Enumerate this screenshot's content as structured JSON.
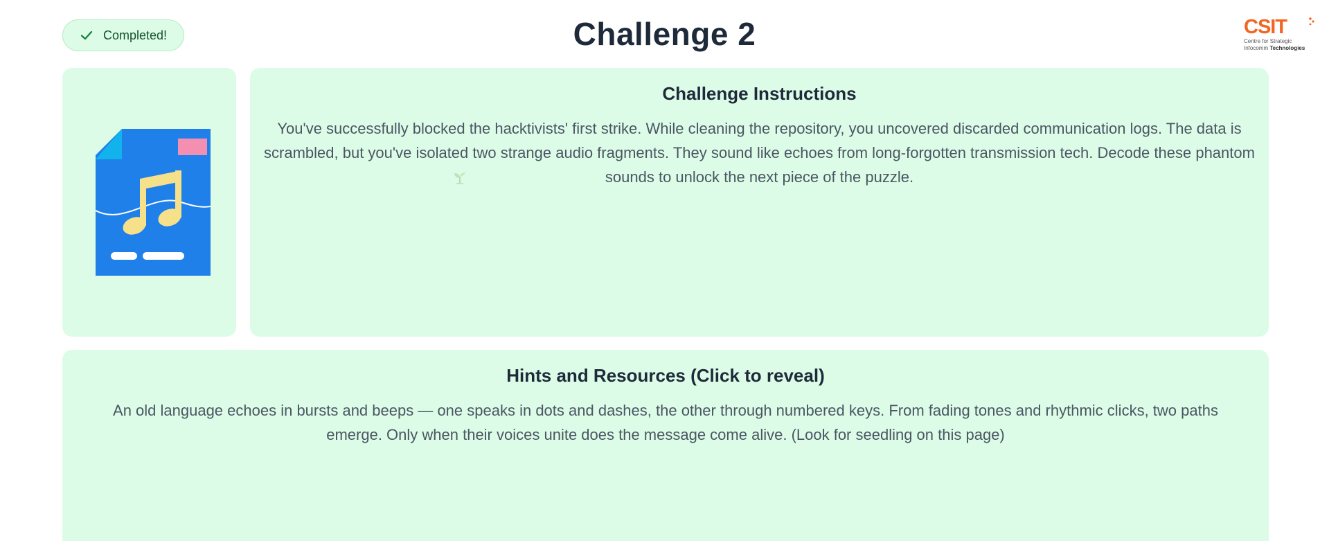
{
  "header": {
    "status_label": "Completed!",
    "title": "Challenge 2"
  },
  "logo": {
    "wordmark": "CSIT",
    "line1": "Centre for Strategic",
    "line2_a": "Infocomm ",
    "line2_b": "Technologies",
    "accent_color": "#f26522"
  },
  "icon_card": {
    "icon": "audio-file-icon"
  },
  "instructions": {
    "heading": "Challenge Instructions",
    "body": "You've successfully blocked the hacktivists' first strike. While cleaning the repository, you uncovered discarded communication logs. The data is scrambled, but you've isolated two strange audio fragments. They sound like echoes from long-forgotten transmission tech. Decode these phantom sounds to unlock the next piece of the puzzle.",
    "hidden_icon": "seedling-icon"
  },
  "hints": {
    "heading": "Hints and Resources (Click to reveal)",
    "body": "An old language echoes in bursts and beeps — one speaks in dots and dashes, the other through numbered keys. From fading tones and rhythmic clicks, two paths emerge. Only when their voices unite does the message come alive. (Look for seedling on this page)"
  },
  "colors": {
    "card_bg": "#dcfce7",
    "title": "#1e2a3a",
    "body_text": "#4b5563",
    "icon_blue": "#1f80ea",
    "icon_yellow": "#f6e08a",
    "icon_pink": "#f48fb1"
  }
}
